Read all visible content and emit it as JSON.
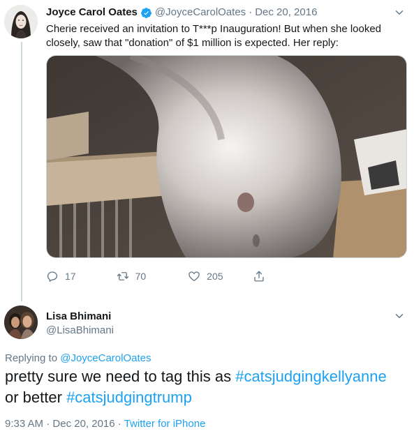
{
  "tweet": {
    "author_name": "Joyce Carol Oates",
    "author_handle": "@JoyceCarolOates",
    "separator": "·",
    "date": "Dec 20, 2016",
    "text": "Cherie received an invitation to T***p Inauguration! But when she looked closely, saw that \"donation\" of $1 million is expected. Her reply:",
    "media_icon": "cat-photo",
    "stats": {
      "replies": "17",
      "retweets": "70",
      "likes": "205"
    }
  },
  "reply": {
    "author_name": "Lisa Bhimani",
    "author_handle": "@LisaBhimani",
    "replying_prefix": "Replying to",
    "replying_to": "@JoyceCarolOates",
    "text_part1": "pretty sure we need to tag this as",
    "hashtag1": "#catsjudgingkellyanne",
    "text_part2": "or better",
    "hashtag2": "#catsjudgingtrump",
    "time": "9:33 AM",
    "separator": "·",
    "date": "Dec 20, 2016",
    "source": "Twitter for iPhone"
  },
  "colors": {
    "link": "#1da1f2",
    "muted": "#657786",
    "text": "#14171a"
  }
}
